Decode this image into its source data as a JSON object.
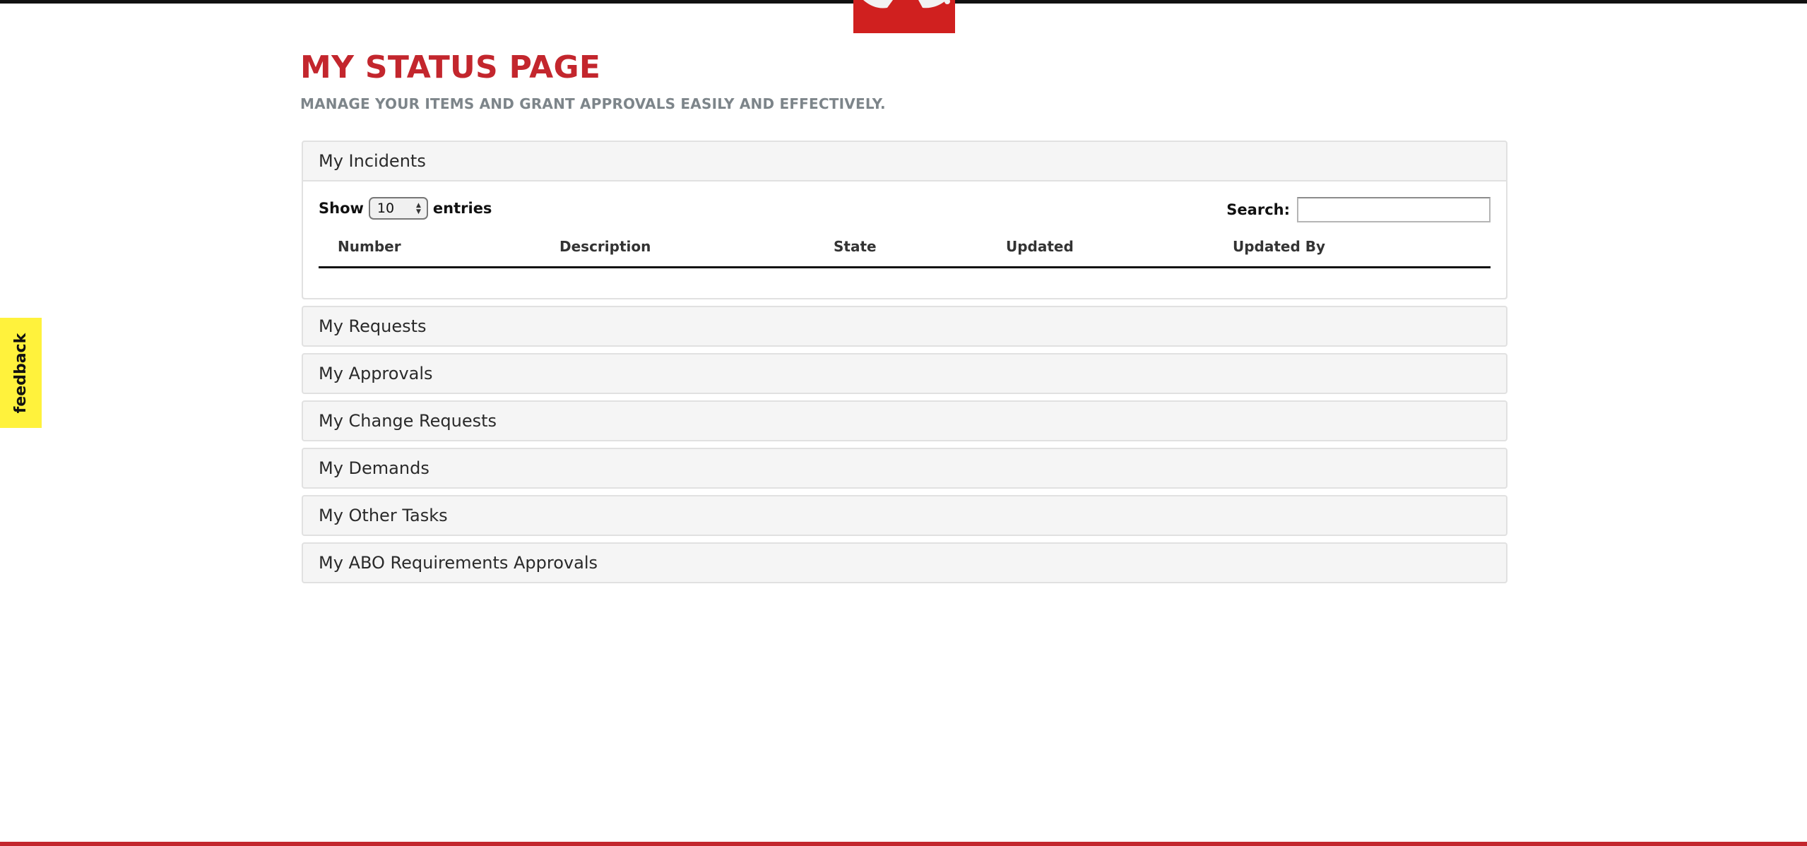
{
  "header": {
    "title": "MY STATUS PAGE",
    "subtitle": "MANAGE YOUR ITEMS AND GRANT APPROVALS EASILY AND EFFECTIVELY."
  },
  "incidents": {
    "heading": "My Incidents",
    "show_label": "Show",
    "entries_value": "10",
    "entries_label": "entries",
    "search_label": "Search:",
    "search_value": "",
    "columns": [
      "Number",
      "Description",
      "State",
      "Updated",
      "Updated By"
    ]
  },
  "sections": [
    "My Requests",
    "My Approvals",
    "My Change Requests",
    "My Demands",
    "My Other Tasks",
    "My ABO Requirements Approvals"
  ],
  "feedback": {
    "label": "feedback"
  },
  "colors": {
    "brand_red": "#c3262d",
    "logo_red": "#d0201f",
    "feedback_yellow": "#fff23c",
    "subtitle_gray": "#7d858a"
  },
  "icons": {
    "logo": "brand-logo-icon",
    "select_arrows": "chevron-up-down-icon"
  }
}
